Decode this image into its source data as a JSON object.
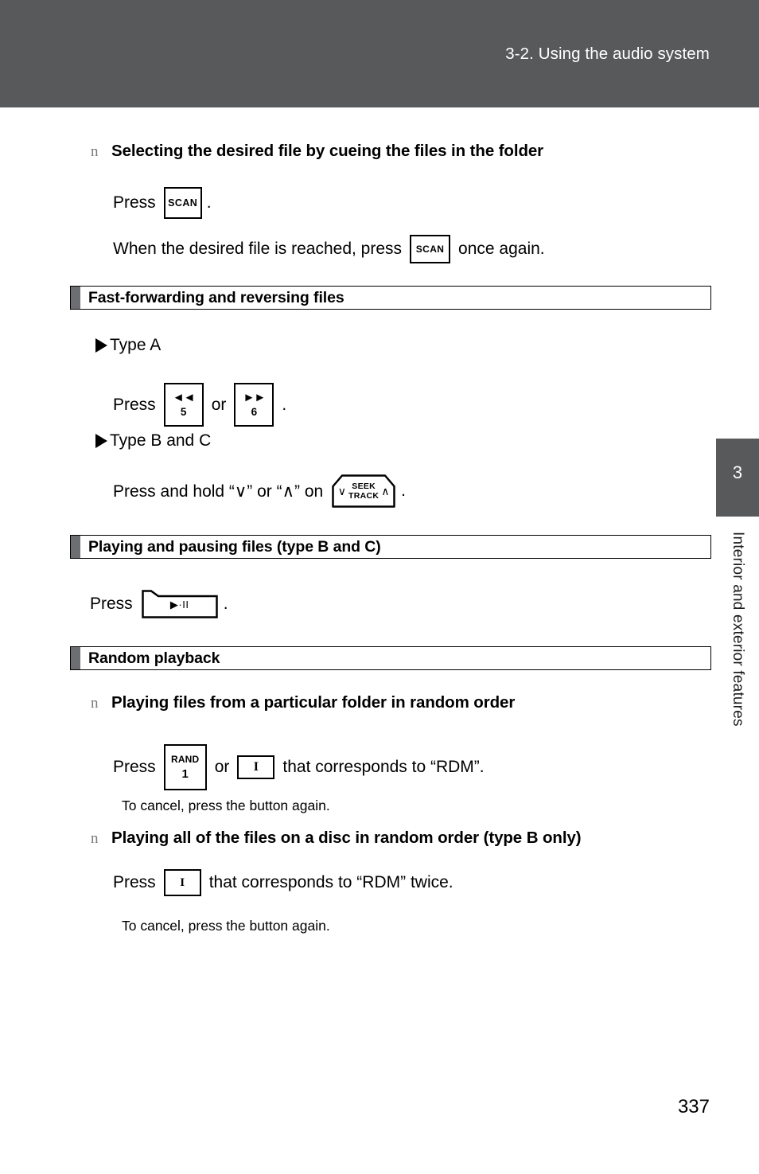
{
  "header": {
    "title": "3-2. Using the audio system",
    "bg_color": "#58595b"
  },
  "side_tab": {
    "chapter_number": "3",
    "chapter_label": "Interior and exterior features",
    "bg_color": "#58595b"
  },
  "page_number": "337",
  "bullet_glyph": "n",
  "blocks": {
    "heading_cueing": "Selecting the desired file by cueing the files in the folder",
    "cue_press_prefix": "Press",
    "cue_press_suffix": ".",
    "cue_when_prefix": "When the desired file is reached, press",
    "cue_when_suffix": "once again.",
    "section_fastforward": "Fast-forwarding and reversing files",
    "type_a": "Type A",
    "ff_press_prefix": "Press",
    "ff_or": "or",
    "ff_press_suffix": ".",
    "type_bc": "Type B and C",
    "seek_hold_prefix": "Press and hold “∨” or “∧” on",
    "seek_hold_suffix": ".",
    "section_playpause": "Playing and pausing files (type B and C)",
    "pp_press_prefix": "Press",
    "pp_press_suffix": ".",
    "section_random": "Random playback",
    "heading_random_folder": "Playing files from a particular folder in random order",
    "rand_press_prefix": "Press",
    "rand_or": "or",
    "rand_press_suffix": "that corresponds to “RDM”.",
    "cancel_note_1": "To cancel, press the button again.",
    "heading_random_disc": "Playing all of the files on a disc in random order (type B only)",
    "disc_press_prefix": "Press",
    "disc_press_suffix": "that corresponds to “RDM” twice.",
    "cancel_note_2": "To cancel, press the button again."
  },
  "keys": {
    "scan": "SCAN",
    "rewind_arrows": "◄◄",
    "rewind_num": "5",
    "forward_arrows": "►►",
    "forward_num": "6",
    "seek_chev_down": "∨",
    "seek_chev_up": "∧",
    "seek_word_1": "SEEK",
    "seek_word_2": "TRACK",
    "playpause_glyph": "▶·II",
    "rand_top": "RAND",
    "rand_bottom": "1",
    "bar": "I"
  }
}
